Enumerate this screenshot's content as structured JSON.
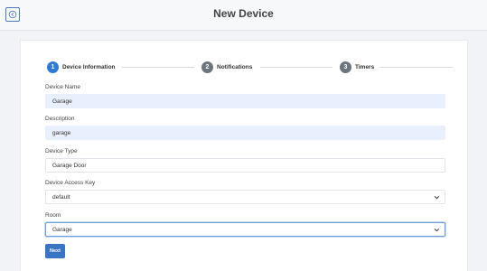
{
  "header": {
    "title": "New Device",
    "back_icon": "arrow-left-circle-icon"
  },
  "stepper": {
    "steps": [
      {
        "number": "1",
        "label": "Device Information",
        "state": "active"
      },
      {
        "number": "2",
        "label": "Notifications",
        "state": "inactive"
      },
      {
        "number": "3",
        "label": "Timers",
        "state": "inactive"
      }
    ]
  },
  "form": {
    "device_name": {
      "label": "Device Name",
      "value": "Garage"
    },
    "description": {
      "label": "Description",
      "value": "garage"
    },
    "device_type": {
      "label": "Device Type",
      "value": "Garage Door"
    },
    "access_key": {
      "label": "Device Access Key",
      "value": "default"
    },
    "room": {
      "label": "Room",
      "value": "Garage"
    }
  },
  "actions": {
    "next_label": "Next"
  },
  "colors": {
    "accent": "#2f79d9",
    "button": "#3a74c4",
    "autofill": "#e8f0fe",
    "inactive_step": "#6c757d"
  }
}
